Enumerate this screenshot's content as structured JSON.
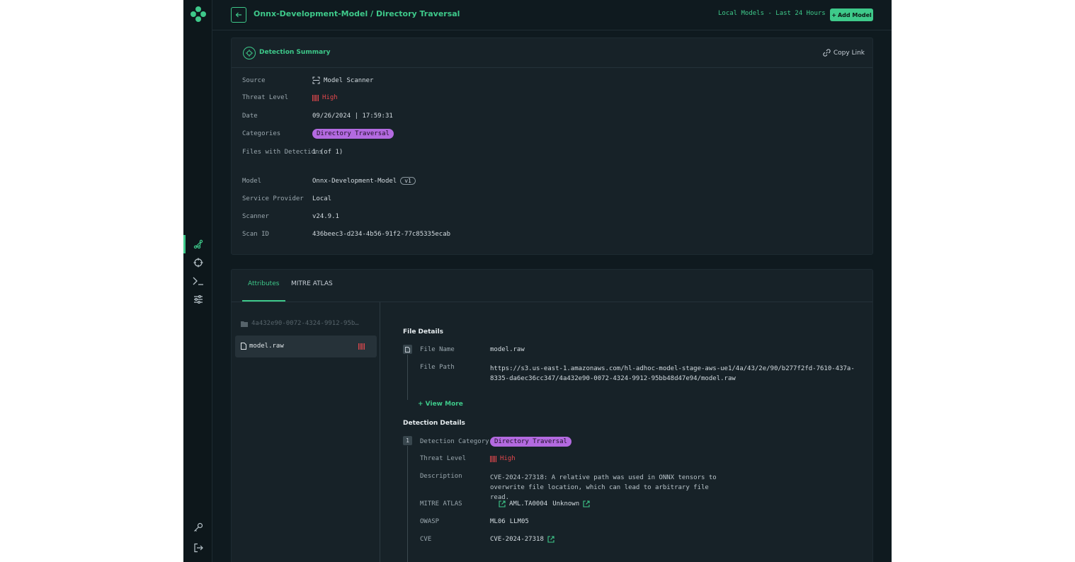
{
  "header": {
    "title": "Onnx-Development-Model / Directory Traversal",
    "scope_label": "Local Models - Last 24 Hours",
    "add_model_label": "Add Model",
    "add_model_plus": "+"
  },
  "summary": {
    "title": "Detection Summary",
    "copy_link_label": "Copy Link",
    "fields": {
      "source_label": "Source",
      "source_value": "Model Scanner",
      "threat_label": "Threat Level",
      "threat_value": "High",
      "date_label": "Date",
      "date_value": "09/26/2024 | 17:59:31",
      "categories_label": "Categories",
      "categories_value": "Directory Traversal",
      "files_label": "Files with Detections",
      "files_value": "1 (of 1)",
      "model_label": "Model",
      "model_value": "Onnx-Development-Model",
      "model_version": "v1",
      "provider_label": "Service Provider",
      "provider_value": "Local",
      "scanner_label": "Scanner",
      "scanner_value": "v24.9.1",
      "scanid_label": "Scan ID",
      "scanid_value": "436beec3-d234-4b56-91f2-77c85335ecab"
    }
  },
  "tabs": [
    {
      "label": "Attributes",
      "active": true
    },
    {
      "label": "MITRE ATLAS",
      "active": false
    }
  ],
  "tree": {
    "folder": "4a432e90-0072-4324-9912-95b…",
    "file": "model.raw"
  },
  "file_details": {
    "title": "File Details",
    "name_label": "File Name",
    "name_value": "model.raw",
    "path_label": "File Path",
    "path_value": "https://s3.us-east-1.amazonaws.com/hl-adhoc-model-stage-aws-ue1/4a/43/2e/90/b277f2fd-7610-437a-8335-da6ec36cc347/4a432e90-0072-4324-9912-95bb48d47e94/model.raw",
    "view_more": "+ View More"
  },
  "detection_details": {
    "title": "Detection Details",
    "index": "1",
    "category_label": "Detection Category",
    "category_value": "Directory Traversal",
    "threat_label": "Threat Level",
    "threat_value": "High",
    "description_label": "Description",
    "description_value": "CVE-2024-27318: A relative path was used in ONNX tensors to overwrite file location, which can lead to arbitrary file read.",
    "atlas_label": "MITRE ATLAS",
    "atlas_id": "AML.TA0004",
    "atlas_name": "Unknown",
    "owasp_label": "OWASP",
    "owasp_values": [
      "ML06",
      "LLM05"
    ],
    "cve_label": "CVE",
    "cve_value": "CVE-2024-27318"
  },
  "colors": {
    "accent": "#3ec98a",
    "danger": "#e5484d",
    "category": "#b36ae0",
    "background": "#0f1a1f",
    "card": "#172228"
  },
  "rail_icons": [
    "logo-icon",
    "graph-icon",
    "crosshair-icon",
    "terminal-icon",
    "sliders-icon",
    "key-icon",
    "logout-icon"
  ]
}
